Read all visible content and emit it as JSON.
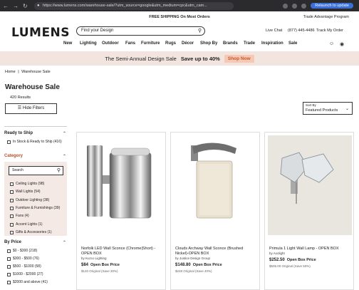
{
  "browser": {
    "url": "https://www.lumens.com/warehouse-sale/?utm_source=google&utm_medium=cpc&utm_cam...",
    "relaunch_label": "Relaunch to update"
  },
  "promo": {
    "shipping": "FREE SHIPPING On Most Orders",
    "trade_program": "Trade Advantage Program"
  },
  "header": {
    "logo": "LUMENS",
    "search_placeholder": "Find your Design",
    "live_chat": "Live Chat",
    "phone": "(877) 445-4486",
    "track_order": "Track My Order"
  },
  "nav": {
    "items": [
      "New",
      "Lighting",
      "Outdoor",
      "Fans",
      "Furniture",
      "Rugs",
      "Décor",
      "Shop By",
      "Brands",
      "Trade",
      "Inspiration",
      "Sale"
    ]
  },
  "banner": {
    "text": "The Semi-Annual Design Sale",
    "offer": "Save up to 40%",
    "cta": "Shop Now"
  },
  "breadcrumb": {
    "home": "Home",
    "separator": "|",
    "current": "Warehouse Sale"
  },
  "page": {
    "title": "Warehouse Sale",
    "results": "420 Results",
    "hide_filters": "Hide Filters",
    "sort_label": "Sort By",
    "sort_value": "Featured Products"
  },
  "filters": {
    "ready_to_ship": {
      "heading": "Ready to Ship",
      "options": [
        "In Stock & Ready to Ship (416)"
      ]
    },
    "category": {
      "heading": "Category",
      "search_placeholder": "Search",
      "options": [
        "Ceiling Lights (98)",
        "Wall Lights (54)",
        "Outdoor Lighting (38)",
        "Furniture & Furnishings (39)",
        "Fans (4)",
        "Accent Lights (1)",
        "Gifts & Accessories (1)"
      ]
    },
    "price": {
      "heading": "By Price",
      "options": [
        "$0 - $300 (218)",
        "$300 - $500 (76)",
        "$500 - $1000 (58)",
        "$1000 - $2000 (27)",
        "$2000 and above (41)"
      ]
    }
  },
  "products": [
    {
      "name": "Norfolk LED Wall Sconce (Chrome|Short) - OPEN BOX",
      "brand": "by Kuzco Lighting",
      "price": "$84",
      "price_label": "Open Box Price",
      "original": "$120 Original (Save 30%)"
    },
    {
      "name": "Clouds Archway Wall Sconce (Brushed Nickel)-OPEN BOX",
      "brand": "by Justice Design Group",
      "price": "$148.80",
      "price_label": "Open Box Price",
      "original": "$248 Original (Save 40%)"
    },
    {
      "name": "Primula 1 Light Wall Lamp - OPEN BOX",
      "brand": "by Axolight",
      "price": "$252.50",
      "price_label": "Open Box Price",
      "original": "$505.00 Original (Save 50%)"
    }
  ]
}
